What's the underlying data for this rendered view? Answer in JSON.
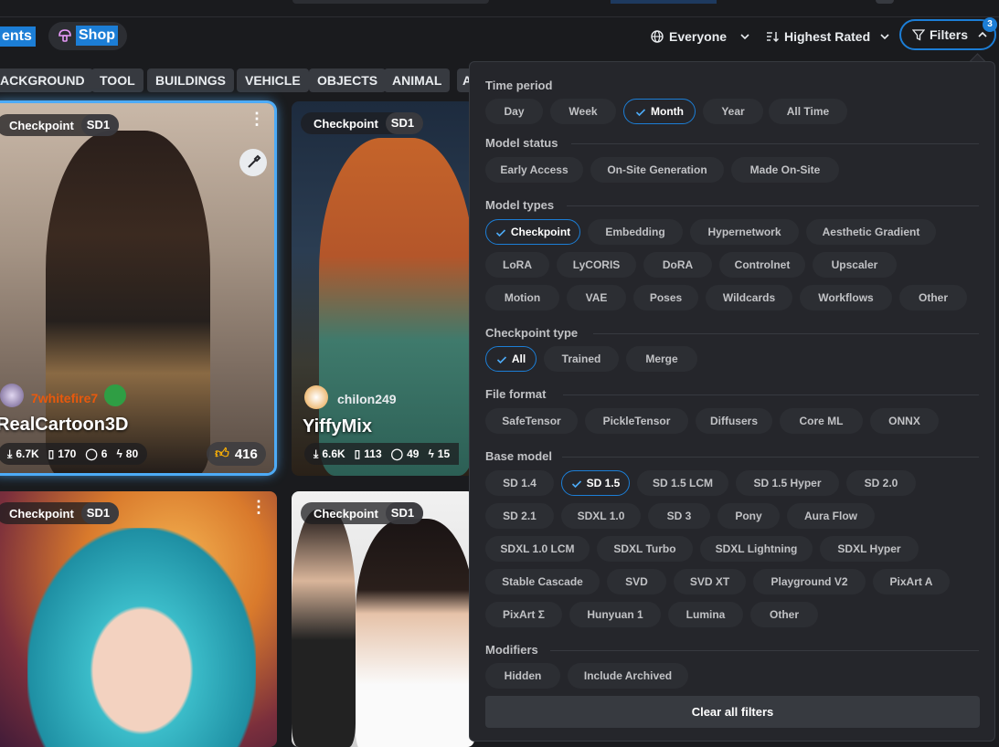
{
  "nav": {
    "events_label": "ents",
    "shop_label": "Shop",
    "everyone_label": "Everyone",
    "sort_label": "Highest Rated",
    "filters_label": "Filters",
    "filters_count": "3"
  },
  "categories": [
    "ACKGROUND",
    "TOOL",
    "BUILDINGS",
    "VEHICLE",
    "OBJECTS",
    "ANIMAL",
    "A"
  ],
  "cards": [
    {
      "type": "Checkpoint",
      "base": "SD1",
      "creator": "7whitefire7",
      "name": "RealCartoon3D",
      "downloads": "6.7K",
      "saves": "170",
      "comments": "6",
      "tips": "80",
      "likes": "416"
    },
    {
      "type": "Checkpoint",
      "base": "SD1",
      "creator": "chilon249",
      "name": "YiffyMix",
      "downloads": "6.6K",
      "saves": "113",
      "comments": "49",
      "tips": "15"
    },
    {
      "type": "Checkpoint",
      "base": "SD1"
    },
    {
      "type": "Checkpoint",
      "base": "SD1"
    }
  ],
  "filters": {
    "time_period": {
      "title": "Time period",
      "options": [
        "Day",
        "Week",
        "Month",
        "Year",
        "All Time"
      ],
      "selected": "Month"
    },
    "model_status": {
      "title": "Model status",
      "options": [
        "Early Access",
        "On-Site Generation",
        "Made On-Site"
      ]
    },
    "model_types": {
      "title": "Model types",
      "options": [
        "Checkpoint",
        "Embedding",
        "Hypernetwork",
        "Aesthetic Gradient",
        "LoRA",
        "LyCORIS",
        "DoRA",
        "Controlnet",
        "Upscaler",
        "Motion",
        "VAE",
        "Poses",
        "Wildcards",
        "Workflows",
        "Other"
      ],
      "selected": "Checkpoint"
    },
    "checkpoint_type": {
      "title": "Checkpoint type",
      "options": [
        "All",
        "Trained",
        "Merge"
      ],
      "selected": "All"
    },
    "file_format": {
      "title": "File format",
      "options": [
        "SafeTensor",
        "PickleTensor",
        "Diffusers",
        "Core ML",
        "ONNX"
      ]
    },
    "base_model": {
      "title": "Base model",
      "options": [
        "SD 1.4",
        "SD 1.5",
        "SD 1.5 LCM",
        "SD 1.5 Hyper",
        "SD 2.0",
        "SD 2.1",
        "SDXL 1.0",
        "SD 3",
        "Pony",
        "Aura Flow",
        "SDXL 1.0 LCM",
        "SDXL Turbo",
        "SDXL Lightning",
        "SDXL Hyper",
        "Stable Cascade",
        "SVD",
        "SVD XT",
        "Playground V2",
        "PixArt A",
        "PixArt Σ",
        "Hunyuan 1",
        "Lumina",
        "Other"
      ],
      "selected": "SD 1.5"
    },
    "modifiers": {
      "title": "Modifiers",
      "options": [
        "Hidden",
        "Include Archived"
      ]
    },
    "clear_label": "Clear all filters"
  },
  "colors": {
    "accent": "#1c7ed6",
    "panel_bg": "#25262b",
    "chip_bg": "#2c2e33",
    "page_bg": "#1a1b1e",
    "card_glow": "#4dabf7"
  },
  "icons": [
    "mushroom-icon",
    "globe-icon",
    "chevron-down-icon",
    "sort-icon",
    "filter-icon",
    "chevron-up-icon",
    "check-icon",
    "download-icon",
    "bookmark-icon",
    "comment-icon",
    "bolt-icon",
    "thumbs-up-icon",
    "brush-icon",
    "more-vertical-icon"
  ]
}
